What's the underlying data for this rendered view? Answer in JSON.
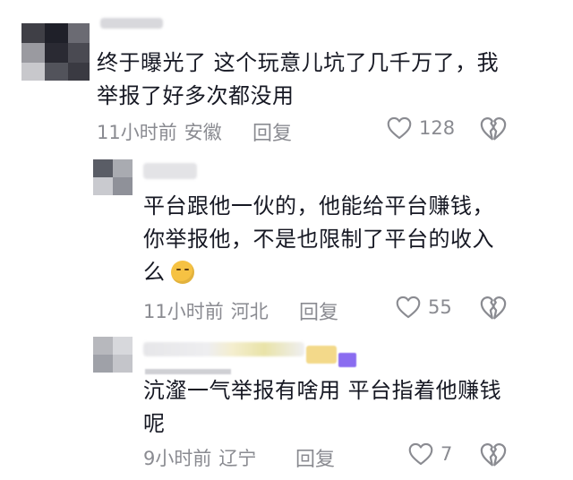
{
  "comments": [
    {
      "text": "终于曝光了 这个玩意儿坑了几千万了，我\n举报了好多次都没用",
      "time": "11小时前",
      "location": "安徽",
      "reply_label": "回复",
      "likes": "128"
    },
    {
      "text": "平台跟他一伙的，他能给平台赚钱，\n你举报他，不是也限制了平台的收入\n么",
      "time": "11小时前",
      "location": "河北",
      "reply_label": "回复",
      "likes": "55"
    },
    {
      "text": "沆瀣一气举报有啥用 平台指着他赚钱\n呢",
      "time": "9小时前",
      "location": "辽宁",
      "reply_label": "回复",
      "likes": "7"
    }
  ],
  "colors": {
    "text": "#161823",
    "meta": "#8a8b91",
    "background": "#ffffff"
  },
  "icons": {
    "like": "heart-outline-icon",
    "dislike": "broken-heart-icon",
    "emoji": "pensive-face-emoji"
  }
}
